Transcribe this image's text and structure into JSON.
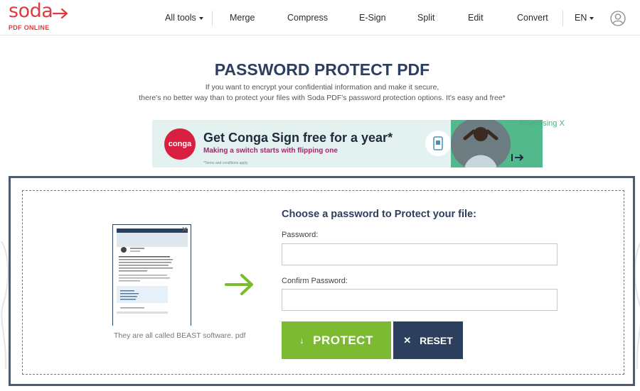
{
  "brand": {
    "name": "soda",
    "subtitle": "PDF ONLINE",
    "color": "#e03a3e"
  },
  "nav": {
    "all_tools": "All tools",
    "merge": "Merge",
    "compress": "Compress",
    "esign": "E-Sign",
    "split": "Split",
    "edit": "Edit",
    "convert": "Convert",
    "language": "EN"
  },
  "page": {
    "title": "PASSWORD PROTECT PDF",
    "subtitle_line1": "If you want to encrypt your confidential information and make it secure,",
    "subtitle_line2": "there's no better way than to protect your files with Soda PDF's password protection options. It's easy and free*"
  },
  "ad": {
    "logo": "conga",
    "headline": "Get Conga Sign free for a year*",
    "subline": "Making a switch starts with flipping one",
    "terms": "*Terms and conditions apply",
    "advertising_label": "Advertising X"
  },
  "file": {
    "name": "They are all called BEAST software. pdf"
  },
  "form": {
    "title": "Choose a password to Protect your file:",
    "password_label": "Password:",
    "password_value": "",
    "confirm_label": "Confirm Password:",
    "confirm_value": "",
    "protect_label": "PROTECT",
    "reset_label": "RESET"
  },
  "colors": {
    "navy": "#2d3f5e",
    "green": "#7cbb31",
    "brand_red": "#e03a3e"
  }
}
